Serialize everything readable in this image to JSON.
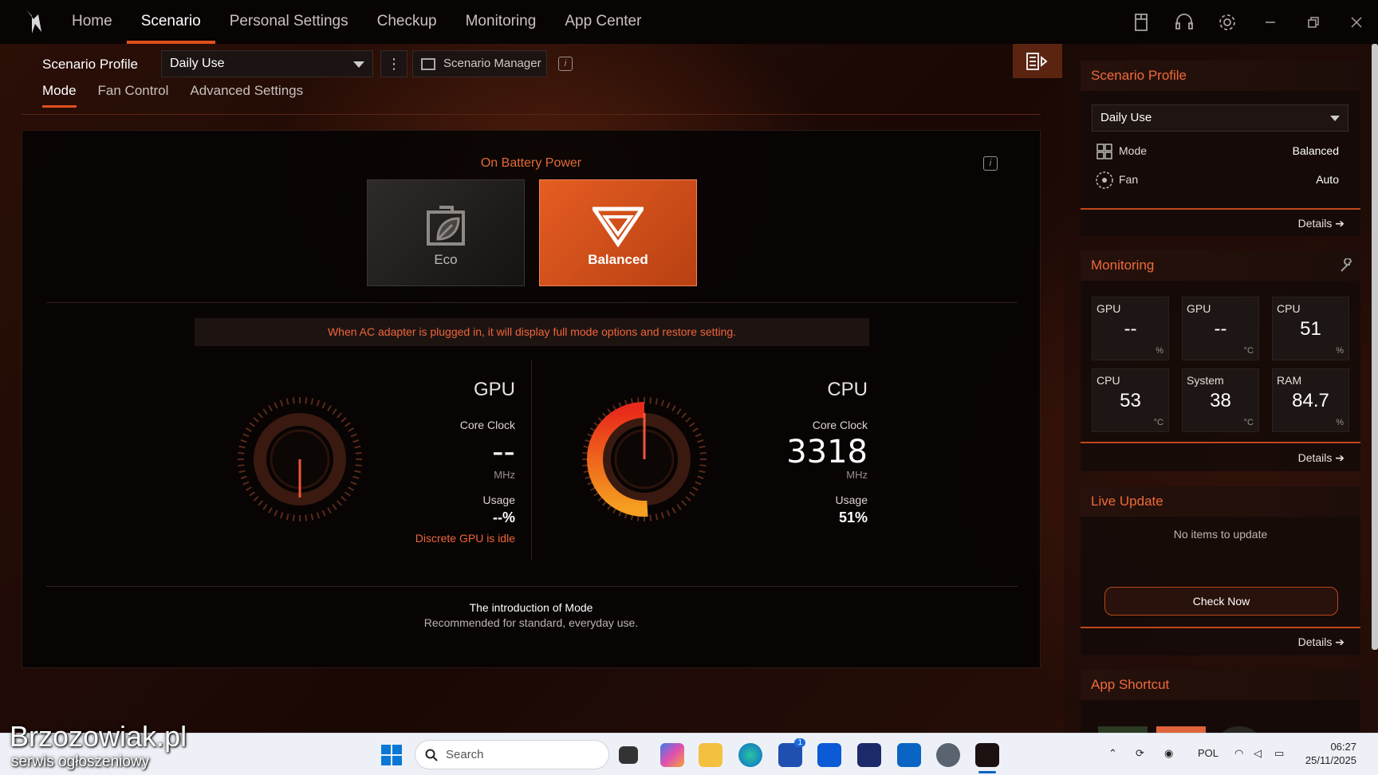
{
  "nav": {
    "tabs": [
      "Home",
      "Scenario",
      "Personal Settings",
      "Checkup",
      "Monitoring",
      "App Center"
    ],
    "active": 1
  },
  "header": {
    "profile_label": "Scenario Profile",
    "profile_value": "Daily Use",
    "manager_label": "Scenario Manager"
  },
  "subtabs": [
    "Mode",
    "Fan Control",
    "Advanced Settings"
  ],
  "mode_panel": {
    "power_state": "On Battery Power",
    "modes": [
      {
        "label": "Eco"
      },
      {
        "label": "Balanced"
      }
    ],
    "ac_notice": "When AC adapter is plugged in, it will display full mode options and restore setting.",
    "gpu": {
      "title": "GPU",
      "clock_label": "Core Clock",
      "clock_value": "--",
      "clock_unit": "MHz",
      "usage_label": "Usage",
      "usage_value": "--%",
      "status": "Discrete GPU is idle",
      "usage_fraction": 0
    },
    "cpu": {
      "title": "CPU",
      "clock_label": "Core Clock",
      "clock_value": "3318",
      "clock_unit": "MHz",
      "usage_label": "Usage",
      "usage_value": "51%",
      "usage_fraction": 0.51
    },
    "intro_title": "The introduction of Mode",
    "intro_desc": "Recommended for standard, everyday use."
  },
  "sidebar": {
    "profile": {
      "title": "Scenario Profile",
      "value": "Daily Use",
      "mode_label": "Mode",
      "mode_value": "Balanced",
      "fan_label": "Fan",
      "fan_value": "Auto",
      "details": "Details"
    },
    "monitoring": {
      "title": "Monitoring",
      "details": "Details",
      "tiles": [
        {
          "label": "GPU",
          "value": "--",
          "unit": "%"
        },
        {
          "label": "GPU",
          "value": "--",
          "unit": "°C"
        },
        {
          "label": "CPU",
          "value": "51",
          "unit": "%"
        },
        {
          "label": "CPU",
          "value": "53",
          "unit": "°C"
        },
        {
          "label": "System",
          "value": "38",
          "unit": "°C"
        },
        {
          "label": "RAM",
          "value": "84.7",
          "unit": "%"
        }
      ]
    },
    "live_update": {
      "title": "Live Update",
      "empty": "No items to update",
      "button": "Check Now",
      "details": "Details"
    },
    "app_shortcut": {
      "title": "App Shortcut"
    }
  },
  "taskbar": {
    "search_placeholder": "Search",
    "language": "POL",
    "time": "06:27",
    "date": "25/11/2025",
    "store_badge": "1"
  },
  "watermark": {
    "line1": "Brzozowiak.pl",
    "line2": "serwis ogłoszeniowy"
  },
  "colors": {
    "accent": "#e0501e",
    "accent_text": "#ee6b3a",
    "warning": "#f0643a"
  }
}
